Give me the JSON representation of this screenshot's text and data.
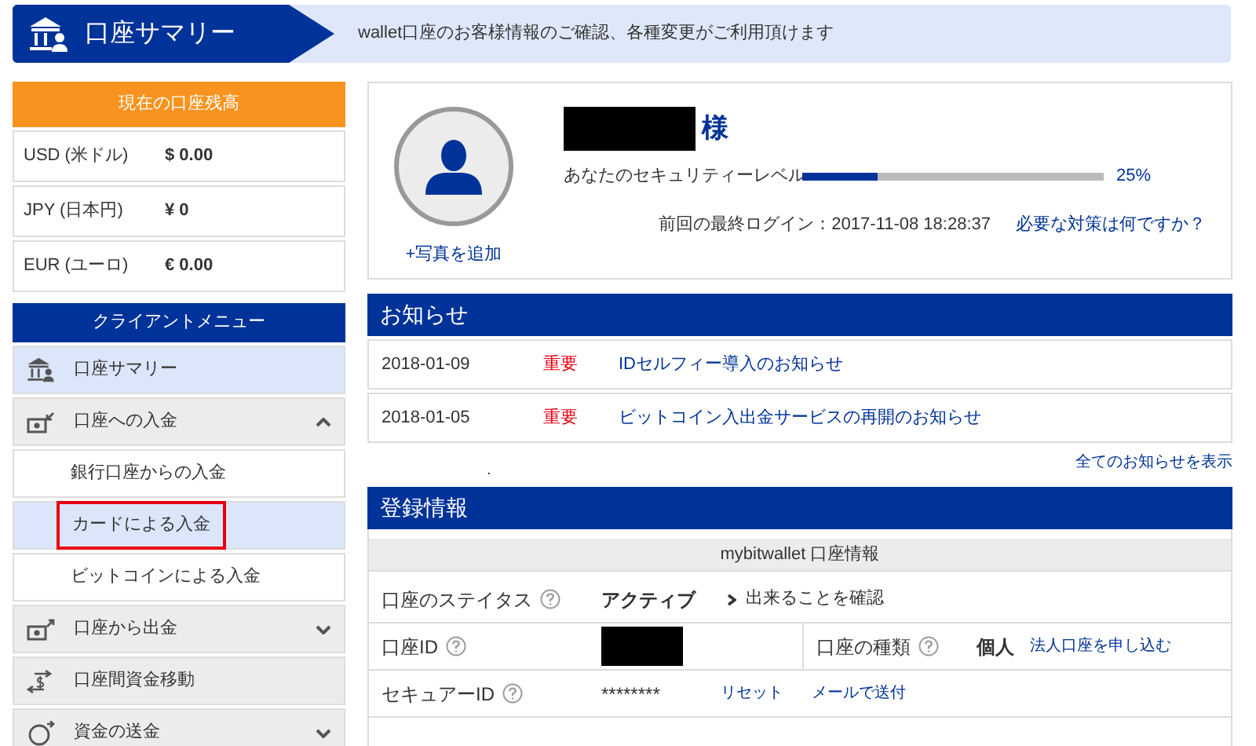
{
  "header": {
    "title": "口座サマリー",
    "description": "wallet口座のお客様情報のご確認、各種変更がご利用頂けます"
  },
  "balance": {
    "title": "現在の口座残高",
    "rows": [
      {
        "currency": "USD (米ドル)",
        "amount": "$ 0.00"
      },
      {
        "currency": "JPY (日本円)",
        "amount": "¥ 0"
      },
      {
        "currency": "EUR (ユーロ)",
        "amount": "€ 0.00"
      }
    ]
  },
  "menu": {
    "title": "クライアントメニュー",
    "items": [
      {
        "kind": "summary",
        "label": "口座サマリー",
        "selected": true
      },
      {
        "kind": "deposit",
        "label": "口座への入金",
        "selected": false,
        "expanded": true,
        "children": [
          {
            "label": "銀行口座からの入金",
            "selected": false,
            "outlined": false
          },
          {
            "label": "カードによる入金",
            "selected": true,
            "outlined": true
          },
          {
            "label": "ビットコインによる入金",
            "selected": false,
            "outlined": false
          }
        ]
      },
      {
        "kind": "withdraw",
        "label": "口座から出金",
        "selected": false,
        "expanded": false
      },
      {
        "kind": "transfer",
        "label": "口座間資金移動",
        "selected": false
      },
      {
        "kind": "remit",
        "label": "資金の送金",
        "selected": false,
        "expanded": false
      }
    ]
  },
  "profile": {
    "honorific": "様",
    "add_photo": "+写真を追加",
    "security_label": "あなたのセキュリティーレベル",
    "security": {
      "level": 0.25
    },
    "security_reading": "25%",
    "last_login": "前回の最終ログイン：2017-11-08 18:28:37",
    "help_link": "必要な対策は何ですか？"
  },
  "notices": {
    "title": "お知らせ",
    "items": [
      {
        "date": "2018-01-09",
        "tag": "重要",
        "title": "IDセルフィー導入のお知らせ"
      },
      {
        "date": "2018-01-05",
        "tag": "重要",
        "title": "ビットコイン入出金サービスの再開のお知らせ"
      }
    ],
    "stray_mark": ".",
    "all_link": "全てのお知らせを表示"
  },
  "registration": {
    "title": "登録情報",
    "subtitle": "mybitwallet 口座情報",
    "status": {
      "label": "口座のステイタス",
      "value": "アクティブ",
      "link": "出来ることを確認"
    },
    "account_id": {
      "label": "口座ID"
    },
    "account_type": {
      "label": "口座の種類",
      "value": "個人",
      "link": "法人口座を申し込む"
    },
    "secure_id": {
      "label": "セキュアーID",
      "value": "********",
      "reset": "リセット",
      "mail": "メールで送付"
    }
  }
}
